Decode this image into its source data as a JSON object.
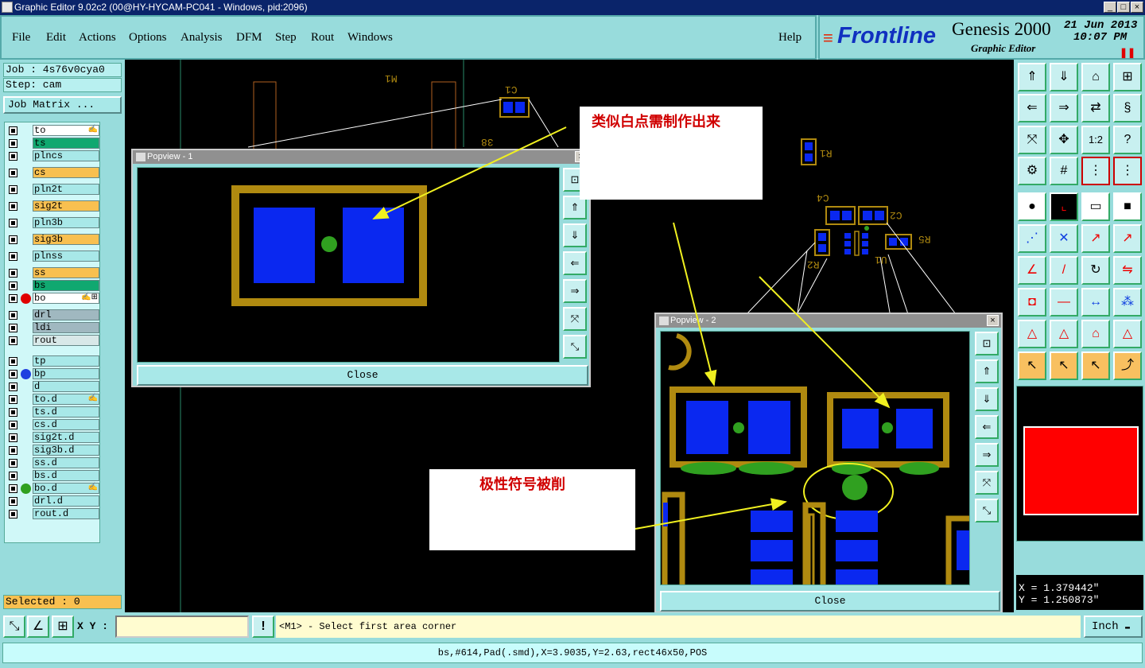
{
  "window": {
    "title": "Graphic Editor 9.02c2 (00@HY-HYCAM-PC041 - Windows, pid:2096)"
  },
  "menu": [
    "File",
    "Edit",
    "Actions",
    "Options",
    "Analysis",
    "DFM",
    "Step",
    "Rout",
    "Windows"
  ],
  "help": "Help",
  "logo": {
    "brand": "Frontline",
    "product": "Genesis 2000",
    "subtitle": "Graphic Editor",
    "date": "21 Jun 2013",
    "time": "10:07 PM"
  },
  "job": {
    "job": "Job : 4s76v0cya0",
    "step": "Step: cam",
    "matrix_btn": "Job Matrix ..."
  },
  "layers": [
    {
      "name": "to",
      "color": "#ffffff",
      "dot": "",
      "mark": "✍"
    },
    {
      "name": "ts",
      "color": "#10a870",
      "dot": "",
      "mark": ""
    },
    {
      "name": "plncs",
      "color": "#a8e8e8",
      "dot": "",
      "mark": ""
    },
    {
      "name": "cs",
      "color": "#f8c050",
      "dot": "",
      "mark": ""
    },
    {
      "name": "pln2t",
      "color": "#a8e8e8",
      "dot": "",
      "mark": ""
    },
    {
      "name": "sig2t",
      "color": "#f8c050",
      "dot": "",
      "mark": ""
    },
    {
      "name": "pln3b",
      "color": "#a8e8e8",
      "dot": "",
      "mark": ""
    },
    {
      "name": "sig3b",
      "color": "#f8c050",
      "dot": "",
      "mark": ""
    },
    {
      "name": "plnss",
      "color": "#a8e8e8",
      "dot": "",
      "mark": ""
    },
    {
      "name": "ss",
      "color": "#f8c050",
      "dot": "",
      "mark": ""
    },
    {
      "name": "bs",
      "color": "#10a870",
      "dot": "",
      "mark": ""
    },
    {
      "name": "bo",
      "color": "#ffffff",
      "dot": "#e00000",
      "mark": "✍⊞"
    },
    {
      "name": "drl",
      "color": "#a0b8c0",
      "dot": "",
      "mark": ""
    },
    {
      "name": "ldi",
      "color": "#a0b8c0",
      "dot": "",
      "mark": ""
    },
    {
      "name": "rout",
      "color": "#d8e8e8",
      "dot": "",
      "mark": ""
    },
    {
      "name": "tp",
      "color": "#a8e8e8",
      "dot": "",
      "mark": ""
    },
    {
      "name": "bp",
      "color": "#a8e8e8",
      "dot": "#2040e0",
      "mark": ""
    },
    {
      "name": "d",
      "color": "#a8e8e8",
      "dot": "",
      "mark": ""
    },
    {
      "name": "to.d",
      "color": "#a8e8e8",
      "dot": "",
      "mark": "✍"
    },
    {
      "name": "ts.d",
      "color": "#a8e8e8",
      "dot": "",
      "mark": ""
    },
    {
      "name": "cs.d",
      "color": "#a8e8e8",
      "dot": "",
      "mark": ""
    },
    {
      "name": "sig2t.d",
      "color": "#a8e8e8",
      "dot": "",
      "mark": ""
    },
    {
      "name": "sig3b.d",
      "color": "#a8e8e8",
      "dot": "",
      "mark": ""
    },
    {
      "name": "ss.d",
      "color": "#a8e8e8",
      "dot": "",
      "mark": ""
    },
    {
      "name": "bs.d",
      "color": "#a8e8e8",
      "dot": "",
      "mark": ""
    },
    {
      "name": "bo.d",
      "color": "#a8e8e8",
      "dot": "#30a020",
      "mark": "✍"
    },
    {
      "name": "drl.d",
      "color": "#a8e8e8",
      "dot": "",
      "mark": ""
    },
    {
      "name": "rout.d",
      "color": "#a8e8e8",
      "dot": "",
      "mark": ""
    }
  ],
  "selected": "Selected : 0",
  "popview1": {
    "title": "Popview - 1",
    "close": "Close"
  },
  "popview2": {
    "title": "Popview - 2",
    "close": "Close"
  },
  "notes": {
    "top": "类似白点需制作出来",
    "bottom": "极性符号被削"
  },
  "canvas_labels": {
    "m1": "M1",
    "c1": "C1",
    "r1": "R1",
    "c4": "C4",
    "c2": "C2",
    "r5": "R5",
    "r2": "R2",
    "u1": "U1",
    "l38": "38"
  },
  "coords": {
    "x": "X = 1.379442\"",
    "y": "Y = 1.250873\""
  },
  "status": {
    "xy_label": "X Y :",
    "xy_value": "",
    "prompt": "<M1> - Select first area corner",
    "unit": "Inch",
    "info": "bs,#614,Pad(.smd),X=3.9035,Y=2.63,rect46x50,POS"
  },
  "colors": {
    "pad": "#0a28f0",
    "outline": "#b08a10",
    "dot": "#30a020",
    "arrow": "#f0f020"
  }
}
